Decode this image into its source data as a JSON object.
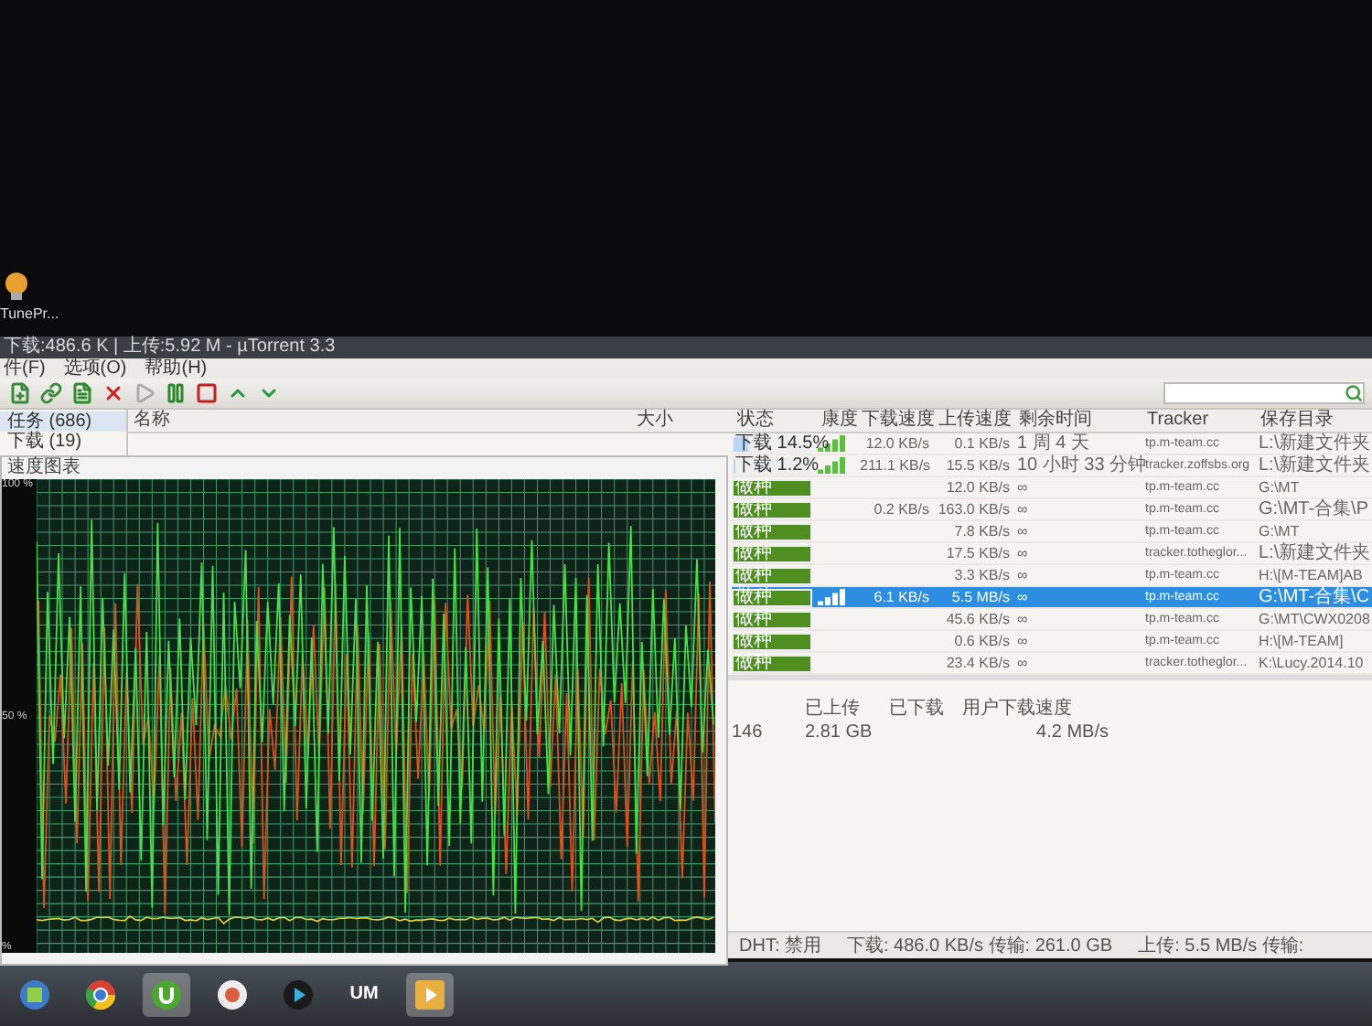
{
  "desktop_icon": {
    "label": "TunePr..."
  },
  "window": {
    "title": "下载:486.6 K | 上传:5.92 M - µTorrent 3.3"
  },
  "menu": [
    "件(F)",
    "选项(O)",
    "帮助(H)"
  ],
  "sidebar": {
    "items": [
      {
        "label": "任务 (686)",
        "selected": true
      },
      {
        "label": "下载 (19)",
        "selected": false
      }
    ]
  },
  "table": {
    "columns": [
      "名称",
      "大小",
      "状态",
      "康度",
      "下载速度",
      "上传速度",
      "剩余时间",
      "Tracker",
      "保存目录"
    ],
    "rows": [
      {
        "status": {
          "kind": "downloading",
          "label": "下载 14.5%",
          "level": 0.145
        },
        "healthy": true,
        "down": "12.0 KB/s",
        "up": "0.1 KB/s",
        "eta": "1 周 4 天",
        "tracker": "tp.m-team.cc",
        "dir": "L:\\新建文件夹",
        "selected": false
      },
      {
        "status": {
          "kind": "downloading",
          "label": "下载 1.2%",
          "level": 0.012
        },
        "healthy": true,
        "down": "211.1 KB/s",
        "up": "15.5 KB/s",
        "eta": "10 小时 33 分钟",
        "tracker": "tracker.zoffsbs.org",
        "dir": "L:\\新建文件夹",
        "selected": false
      },
      {
        "status": {
          "kind": "seeding",
          "label": "做种",
          "level": 1
        },
        "up": "12.0 KB/s",
        "eta": "∞",
        "tracker": "tp.m-team.cc",
        "dir": "G:\\MT",
        "selected": false
      },
      {
        "status": {
          "kind": "seeding",
          "label": "做种",
          "level": 1
        },
        "down": "0.2 KB/s",
        "up": "163.0 KB/s",
        "eta": "∞",
        "tracker": "tp.m-team.cc",
        "dir": "G:\\MT-合集\\P",
        "selected": false
      },
      {
        "status": {
          "kind": "seeding",
          "label": "做种",
          "level": 1
        },
        "up": "7.8 KB/s",
        "eta": "∞",
        "tracker": "tp.m-team.cc",
        "dir": "G:\\MT",
        "selected": false
      },
      {
        "status": {
          "kind": "seeding",
          "label": "做种",
          "level": 1
        },
        "up": "17.5 KB/s",
        "eta": "∞",
        "tracker": "tracker.totheglor...",
        "dir": "L:\\新建文件夹",
        "selected": false
      },
      {
        "status": {
          "kind": "seeding",
          "label": "做种",
          "level": 1
        },
        "up": "3.3 KB/s",
        "eta": "∞",
        "tracker": "tp.m-team.cc",
        "dir": "H:\\[M-TEAM]AB",
        "selected": false
      },
      {
        "status": {
          "kind": "seeding",
          "label": "做种",
          "level": 1
        },
        "healthy": true,
        "down": "6.1 KB/s",
        "up": "5.5 MB/s",
        "eta": "∞",
        "tracker": "tp.m-team.cc",
        "dir": "G:\\MT-合集\\C",
        "selected": true
      },
      {
        "status": {
          "kind": "seeding",
          "label": "做种",
          "level": 1
        },
        "up": "45.6 KB/s",
        "eta": "∞",
        "tracker": "tp.m-team.cc",
        "dir": "G:\\MT\\CWX0208",
        "selected": false
      },
      {
        "status": {
          "kind": "seeding",
          "label": "做种",
          "level": 1
        },
        "up": "0.6 KB/s",
        "eta": "∞",
        "tracker": "tp.m-team.cc",
        "dir": "H:\\[M-TEAM]",
        "selected": false
      },
      {
        "status": {
          "kind": "seeding",
          "label": "做种",
          "level": 1
        },
        "up": "23.4 KB/s",
        "eta": "∞",
        "tracker": "tracker.totheglor...",
        "dir": "K:\\Lucy.2014.10",
        "selected": false
      }
    ]
  },
  "details": {
    "lead_value": "146",
    "columns": [
      {
        "header": "已上传",
        "value": "2.81 GB"
      },
      {
        "header": "已下载"
      },
      {
        "header": "用户下载速度",
        "value": "4.2 MB/s"
      }
    ]
  },
  "graph": {
    "title": "速度图表",
    "axis_labels": [
      "100 %",
      "50 %",
      "%"
    ]
  },
  "status_bar": [
    "DHT: 禁用",
    "下载: 486.0 KB/s 传输: 261.0 GB",
    "上传: 5.5 MB/s 传输:"
  ],
  "taskbar": [
    {
      "kind": "start",
      "selected": false
    },
    {
      "kind": "chrome",
      "selected": false
    },
    {
      "kind": "utorrent",
      "selected": true
    },
    {
      "kind": "circle",
      "selected": false
    },
    {
      "kind": "media",
      "selected": false
    },
    {
      "kind": "label",
      "label": "UM",
      "selected": false
    },
    {
      "kind": "player",
      "selected": true
    }
  ]
}
